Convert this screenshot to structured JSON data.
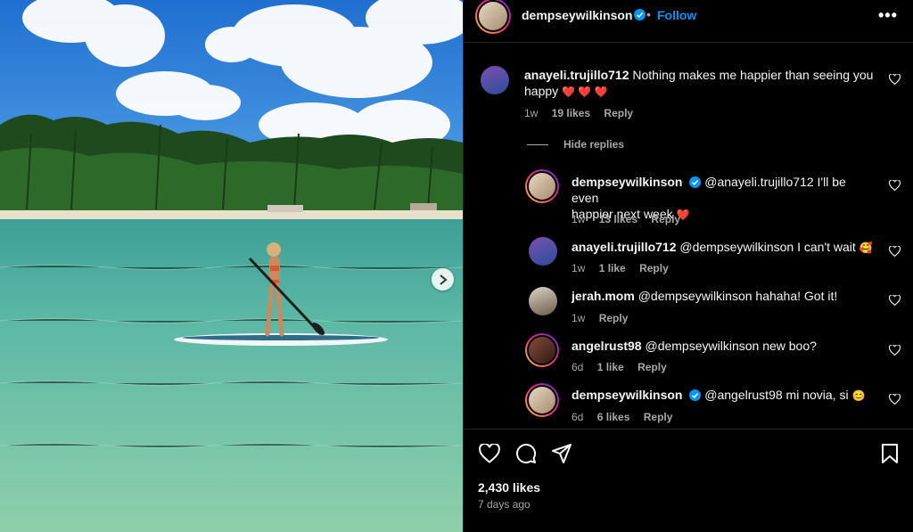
{
  "post": {
    "author": "dempseywilkinson",
    "separator": "•",
    "follow_label": "Follow",
    "more_label": "•••",
    "likes": "2,430 likes",
    "posted": "7 days ago"
  },
  "hide_replies_label": "Hide replies",
  "reply_label": "Reply",
  "comments": [
    {
      "user": "anayeli.trujillo712",
      "text": "Nothing makes me happier than seeing you",
      "text2": "happy",
      "emoji": "❤️ ❤️ ❤️",
      "time": "1w",
      "likes": "19 likes"
    },
    {
      "user": "dempseywilkinson",
      "text": "@anayeli.trujillo712 I'll be even",
      "text2": "happier next week",
      "emoji": "❤️",
      "time": "1w",
      "likes": "13 likes"
    },
    {
      "user": "anayeli.trujillo712",
      "text": "@dempseywilkinson I can't wait",
      "emoji": "🥰",
      "time": "1w",
      "likes": "1 like"
    },
    {
      "user": "jerah.mom",
      "text": "@dempseywilkinson hahaha! Got it!",
      "time": "1w",
      "likes": ""
    },
    {
      "user": "angelrust98",
      "text": "@dempseywilkinson new boo?",
      "time": "6d",
      "likes": "1 like"
    },
    {
      "user": "dempseywilkinson",
      "text": "@angelrust98 mi novia, si",
      "emoji": "😊",
      "time": "6d",
      "likes": "6 likes"
    }
  ],
  "colors": {
    "accent": "#0095f6",
    "muted": "#a8a8a8",
    "heart": "#ff3040"
  },
  "icons": [
    "verified-badge-icon",
    "heart-icon",
    "comment-icon",
    "share-icon",
    "bookmark-icon",
    "chevron-right-icon",
    "more-icon"
  ]
}
